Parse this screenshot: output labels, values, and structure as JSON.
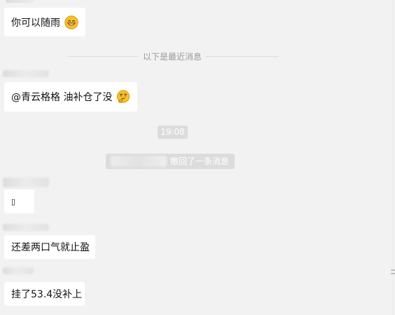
{
  "messages": {
    "m1_text": "你可以随雨",
    "m1_emoji": "grin-emoji",
    "divider_label": "以下是最近消息",
    "m2_text": "@青云格格 油补仓了没",
    "m2_emoji": "thinking-emoji",
    "time_label": "19:08",
    "recall_text": "撤回了一条消息",
    "m3_text": "▯",
    "m4_text": "还差两口气就止盈",
    "m5_text": "挂了53.4没补上"
  },
  "colors": {
    "background": "#f2f2f2",
    "bubble": "#ffffff",
    "system_chip": "#dcdcdc",
    "divider_text": "#9a9a9a",
    "emoji_face": "#f6c12a"
  }
}
